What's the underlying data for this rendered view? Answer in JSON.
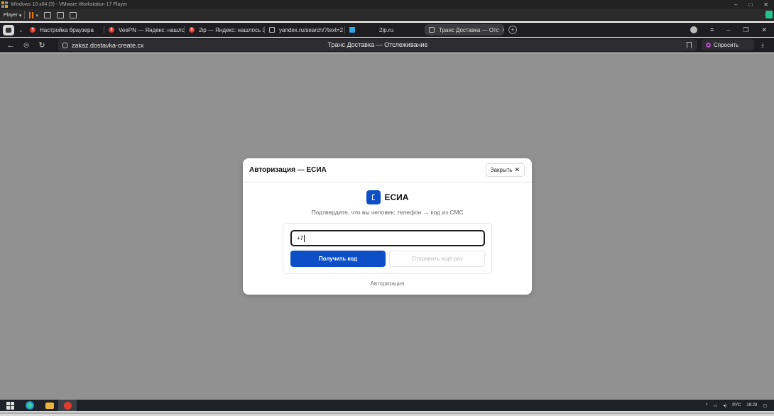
{
  "vmware": {
    "title": "Windows 10 x64 (3) - VMware Workstation 17 Player",
    "player_menu": "Player",
    "accent": "#e07a1a"
  },
  "browser": {
    "tabs": [
      {
        "label": "Настройка браузера",
        "favicon_color": "#e33b2e",
        "favicon_glyph": "Y",
        "active": false
      },
      {
        "label": "VeePN — Яндекс: нашлось",
        "favicon_color": "#e33b2e",
        "favicon_glyph": "8",
        "active": false
      },
      {
        "label": "2ip — Яндекс: нашлось 3",
        "favicon_color": "#e33b2e",
        "favicon_glyph": "8",
        "active": false
      },
      {
        "label": "yandex.ru/search/?text=2",
        "favicon_color": "#888888",
        "favicon_glyph": "",
        "active": false
      },
      {
        "label": "2ip.ru",
        "favicon_color": "#2fa7e0",
        "favicon_glyph": "",
        "active": false
      },
      {
        "label": "Транс Доставка — Отс",
        "favicon_color": "#888888",
        "favicon_glyph": "",
        "active": true
      }
    ],
    "url": "zakaz.dostavka-create.cx",
    "page_title": "Транс Доставка — Отслеживание",
    "ask_label": "Спросить"
  },
  "modal": {
    "title": "Авторизация — ЕСИА",
    "close_label": "Закрыть",
    "brand_name": "ЕСИА",
    "subtitle": "Подтвердите, что вы человек: телефон → код из СМС",
    "phone_value": "+7",
    "get_code_label": "Получить код",
    "resend_label": "Отправить ещё раз",
    "footer_text": "Авторизация",
    "brand_color": "#0d4fc6"
  },
  "taskbar": {
    "lang": "РУС",
    "time": "19:28",
    "date": ""
  }
}
